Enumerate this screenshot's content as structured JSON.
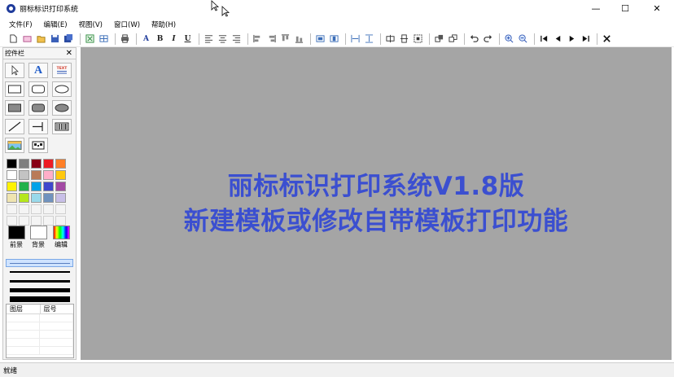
{
  "window": {
    "title": "丽标标识打印系统",
    "controls": {
      "minimize": "—",
      "maximize": "☐",
      "close": "✕"
    }
  },
  "menu": [
    "文件(F)",
    "编辑(E)",
    "视图(V)",
    "窗口(W)",
    "帮助(H)"
  ],
  "toolbar": {
    "groups": [
      [
        "new-file-icon",
        "open-template-icon",
        "open-folder-icon",
        "save-icon",
        "save-all-icon"
      ],
      [
        "export-excel-icon",
        "grid-icon"
      ],
      [
        "print-icon"
      ],
      [
        "font-icon",
        "bold-icon",
        "italic-icon",
        "underline-icon"
      ],
      [
        "align-left-icon",
        "align-center-icon",
        "align-right-icon"
      ],
      [
        "align-objects-left-icon",
        "align-objects-right-icon",
        "align-objects-top-icon",
        "align-objects-bottom-icon"
      ],
      [
        "same-width-icon",
        "same-height-icon"
      ],
      [
        "distribute-horizontal-icon",
        "distribute-vertical-icon"
      ],
      [
        "center-horizontal-icon",
        "center-vertical-icon",
        "center-both-icon"
      ],
      [
        "bring-front-icon",
        "send-back-icon"
      ],
      [
        "undo-icon",
        "redo-icon"
      ],
      [
        "zoom-in-icon",
        "zoom-out-icon"
      ],
      [
        "first-page-icon",
        "prev-page-icon",
        "next-page-icon",
        "last-page-icon"
      ],
      [
        "close-document-icon"
      ]
    ],
    "text_buttons": {
      "font": "A",
      "bold": "B",
      "italic": "I",
      "underline": "U"
    }
  },
  "control_panel": {
    "title": "控件栏",
    "close": "✕",
    "tools": [
      "select-pointer-icon",
      "text-tool-icon",
      "multiline-text-icon",
      "rectangle-icon",
      "rounded-rectangle-icon",
      "ellipse-icon",
      "filled-rectangle-icon",
      "filled-rounded-rectangle-icon",
      "filled-ellipse-icon",
      "line-icon",
      "dimension-line-icon",
      "barcode-icon",
      "image-icon",
      "qrcode-icon"
    ],
    "text_tool_glyph": "A",
    "multiline_glyph": "TEXT",
    "palette": [
      "#000000",
      "#7f7f7f",
      "#880015",
      "#ed1c24",
      "#ff7f27",
      "#ffffff",
      "#c3c3c3",
      "#b97a57",
      "#ffaec9",
      "#ffc90e",
      "#fff200",
      "#22b14c",
      "#00a2e8",
      "#3f48cc",
      "#a349a4",
      "#efe4b0",
      "#b5e61d",
      "#99d9ea",
      "#7092be",
      "#c8bfe7",
      "#f4f4f4",
      "#f4f4f4",
      "#f4f4f4",
      "#f4f4f4",
      "#f4f4f4",
      "#f4f4f4",
      "#f4f4f4",
      "#f4f4f4",
      "#f4f4f4",
      "#f4f4f4"
    ],
    "foreground": {
      "label": "前景",
      "color": "#000000"
    },
    "background": {
      "label": "背景",
      "color": "#ffffff"
    },
    "edit_color": {
      "label": "编辑"
    },
    "line_widths": [
      1,
      2,
      3,
      5,
      7,
      9
    ],
    "layers": {
      "col_layer": "图层",
      "col_index": "层号"
    }
  },
  "canvas": {
    "background": "#a5a5a5",
    "line1": "丽标标识打印系统V1.8版",
    "line2": "新建模板或修改自带模板打印功能",
    "text_color": "#3b4fd0"
  },
  "status": {
    "text": "就绪"
  }
}
